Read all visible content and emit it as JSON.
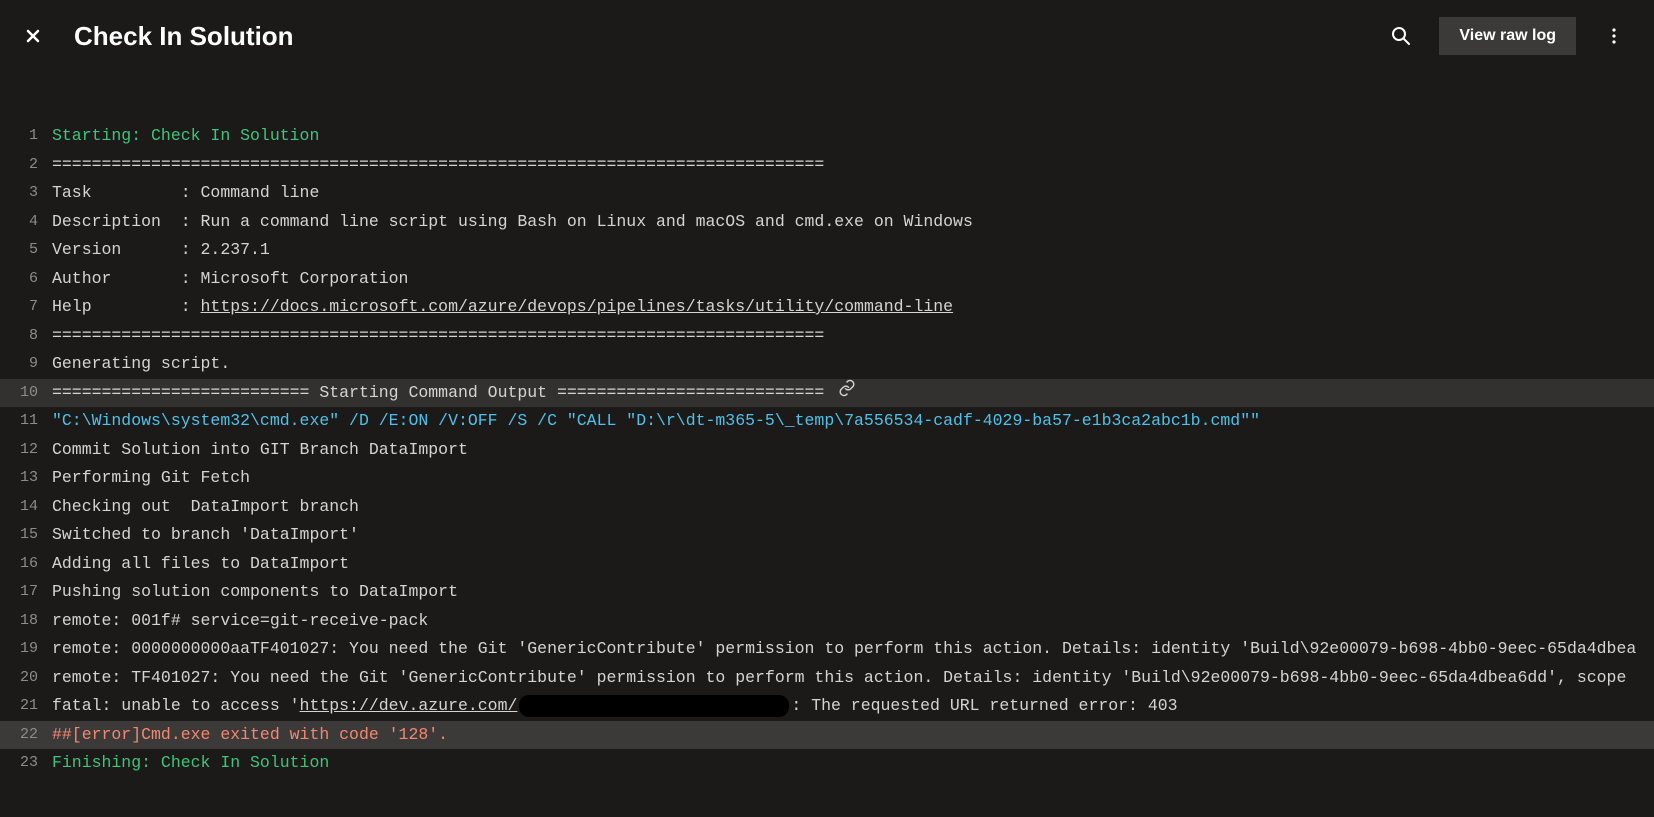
{
  "header": {
    "title": "Check In Solution",
    "view_raw_log": "View raw log"
  },
  "log": {
    "lines": [
      {
        "n": 1,
        "cls": "c-green",
        "text": "Starting: Check In Solution"
      },
      {
        "n": 2,
        "text": "=============================================================================="
      },
      {
        "n": 3,
        "text": "Task         : Command line"
      },
      {
        "n": 4,
        "text": "Description  : Run a command line script using Bash on Linux and macOS and cmd.exe on Windows"
      },
      {
        "n": 5,
        "text": "Version      : 2.237.1"
      },
      {
        "n": 6,
        "text": "Author       : Microsoft Corporation"
      },
      {
        "n": 7,
        "text_pre": "Help         : ",
        "link": "https://docs.microsoft.com/azure/devops/pipelines/tasks/utility/command-line"
      },
      {
        "n": 8,
        "text": "=============================================================================="
      },
      {
        "n": 9,
        "text": "Generating script."
      },
      {
        "n": 10,
        "hl": true,
        "linkicon": true,
        "text": "========================== Starting Command Output ==========================="
      },
      {
        "n": 11,
        "cls": "c-cyan",
        "text": "\"C:\\Windows\\system32\\cmd.exe\" /D /E:ON /V:OFF /S /C \"CALL \"D:\\r\\dt-m365-5\\_temp\\7a556534-cadf-4029-ba57-e1b3ca2abc1b.cmd\"\""
      },
      {
        "n": 12,
        "text": "Commit Solution into GIT Branch DataImport"
      },
      {
        "n": 13,
        "text": "Performing Git Fetch"
      },
      {
        "n": 14,
        "text": "Checking out  DataImport branch"
      },
      {
        "n": 15,
        "text": "Switched to branch 'DataImport'"
      },
      {
        "n": 16,
        "text": "Adding all files to DataImport"
      },
      {
        "n": 17,
        "text": "Pushing solution components to DataImport"
      },
      {
        "n": 18,
        "text": "remote: 001f# service=git-receive-pack"
      },
      {
        "n": 19,
        "text": "remote: 0000000000aaTF401027: You need the Git 'GenericContribute' permission to perform this action. Details: identity 'Build\\92e00079-b698-4bb0-9eec-65da4dbea"
      },
      {
        "n": 20,
        "text": "remote: TF401027: You need the Git 'GenericContribute' permission to perform this action. Details: identity 'Build\\92e00079-b698-4bb0-9eec-65da4dbea6dd', scope "
      },
      {
        "n": 21,
        "text_pre": "fatal: unable to access '",
        "link": "https://dev.azure.com/",
        "redact": true,
        "text_post": ": The requested URL returned error: 403"
      },
      {
        "n": 22,
        "errhl": true,
        "cls": "c-err",
        "text": "##[error]Cmd.exe exited with code '128'."
      },
      {
        "n": 23,
        "cls": "c-green",
        "text": "Finishing: Check In Solution"
      }
    ]
  }
}
